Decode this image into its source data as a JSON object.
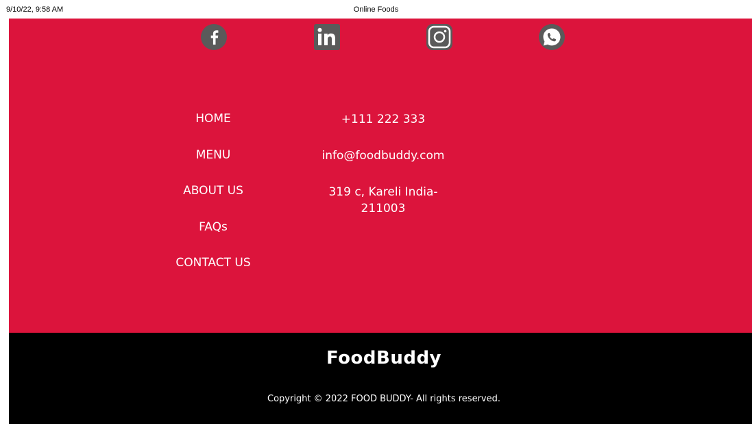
{
  "print_header": {
    "date_time": "9/10/22, 9:58 AM",
    "page_title": "Online Foods"
  },
  "social": {
    "icons": [
      "facebook-icon",
      "linkedin-icon",
      "instagram-icon",
      "whatsapp-icon"
    ],
    "icon_color": "#5a5a5a"
  },
  "nav": {
    "home": "HOME",
    "menu": "MENU",
    "about": "ABOUT US",
    "faqs": "FAQs",
    "contact": "CONTACT US"
  },
  "contact": {
    "phone": "+111 222 333",
    "email": "info@foodbuddy.com",
    "address_line1": "319 c, Kareli India-",
    "address_line2": "211003"
  },
  "footer": {
    "brand": "FoodBuddy",
    "copyright": "Copyright © 2022 FOOD BUDDY- All rights reserved."
  },
  "colors": {
    "footer_top_bg": "#dc143c",
    "footer_bottom_bg": "#000000",
    "text": "#ffffff"
  }
}
